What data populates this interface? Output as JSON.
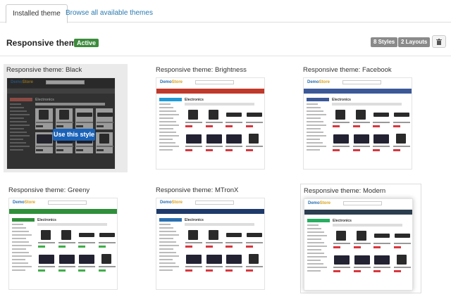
{
  "tabs": {
    "installed": "Installed theme",
    "browse": "Browse all available themes"
  },
  "header": {
    "title": "Responsive theme",
    "badge": "Active",
    "styles": "8 Styles",
    "layouts": "2 Layouts"
  },
  "cards": [
    {
      "label": "Responsive theme: Black",
      "nav": "#555555",
      "accent": "#e0675a",
      "price": "#444444"
    },
    {
      "label": "Responsive theme: Brightness",
      "nav": "#c0392b",
      "accent": "#1f9bd7",
      "price": "#d9363e"
    },
    {
      "label": "Responsive theme: Facebook",
      "nav": "#3b5998",
      "accent": "#3b5998",
      "price": "#d9363e"
    },
    {
      "label": "Responsive theme: Greeny",
      "nav": "#2f8f3a",
      "accent": "#2f8f3a",
      "price": "#3fae49"
    },
    {
      "label": "Responsive theme: MTronX",
      "nav": "#1e3a6a",
      "accent": "#2a6fb0",
      "price": "#d9363e"
    },
    {
      "label": "Responsive theme: Modern",
      "nav": "#2b3e4f",
      "accent": "#27ae60",
      "price": "#d9363e"
    }
  ],
  "thumb_text": {
    "logo_a": "Demo",
    "logo_b": "Store",
    "heading": "Electronics"
  },
  "use_button": "Use this style",
  "icons": {
    "trash": "trash-icon"
  }
}
